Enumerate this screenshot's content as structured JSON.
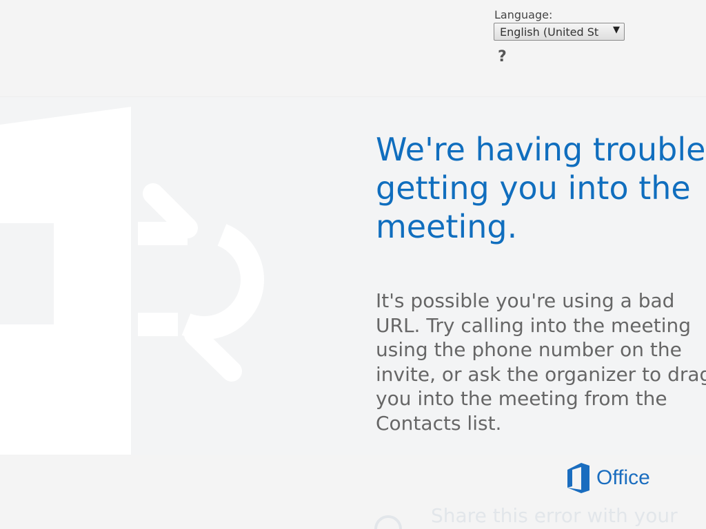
{
  "language": {
    "label": "Language:",
    "selected": "English (United St"
  },
  "help": {
    "icon": "help-icon",
    "glyph": "?"
  },
  "error": {
    "headline": "We're having trouble\ngetting you into the\nmeeting.",
    "message": "It's possible you're using a bad\nURL. Try calling into the meeting\nusing the phone number on the\ninvite, or ask the organizer to drag\nyou into the meeting from the\nContacts list."
  },
  "footer": {
    "logo_text": "Office",
    "share_text": "Share this error with your"
  },
  "colors": {
    "accent": "#106ebe",
    "office_logo": "#1a6dbf"
  }
}
